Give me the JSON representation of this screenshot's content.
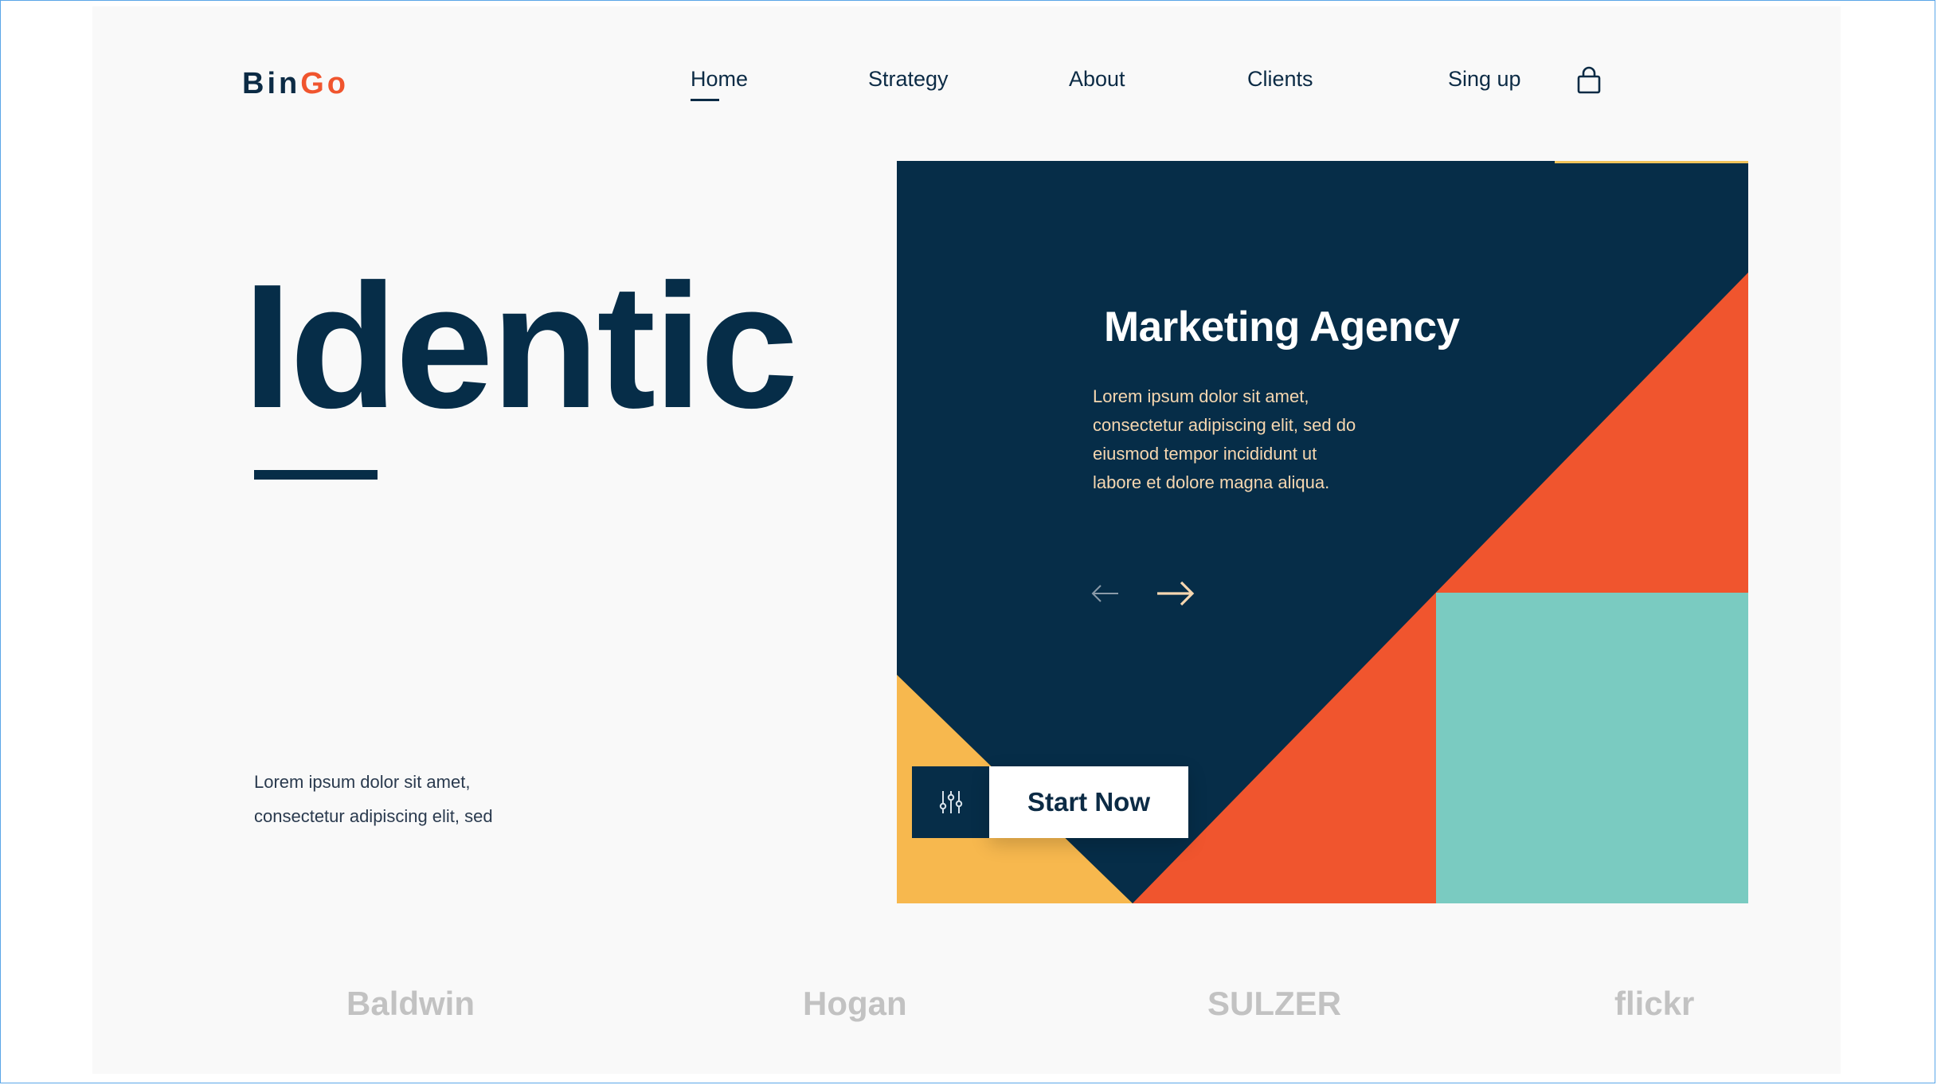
{
  "header": {
    "logo": {
      "part1": "Bin",
      "part2": "Go"
    },
    "nav": [
      {
        "label": "Home",
        "active": true
      },
      {
        "label": "Strategy",
        "active": false
      },
      {
        "label": "About",
        "active": false
      },
      {
        "label": "Clients",
        "active": false
      }
    ],
    "signup_label": "Sing up",
    "cart_icon": "shopping-bag-icon"
  },
  "hero": {
    "title": "Identic",
    "description_line1": "Lorem ipsum dolor sit amet,",
    "description_line2": "consectetur adipiscing elit, sed"
  },
  "card": {
    "title": "Marketing Agency",
    "text_lines": [
      "Lorem ipsum dolor sit amet,",
      "consectetur adipiscing elit, sed do",
      "eiusmod tempor incididunt ut",
      "labore et dolore magna aliqua."
    ],
    "prev_icon": "arrow-left-icon",
    "next_icon": "arrow-right-icon"
  },
  "cta": {
    "icon": "sliders-icon",
    "label": "Start Now"
  },
  "brands": [
    "Baldwin",
    "Hogan",
    "SULZER",
    "flickr"
  ],
  "colors": {
    "navy": "#062d48",
    "orange": "#f0552e",
    "yellow": "#f7b84e",
    "teal": "#7acbc1",
    "cream_text": "#f6d7b0",
    "brand_gray": "#c2c2c2"
  }
}
